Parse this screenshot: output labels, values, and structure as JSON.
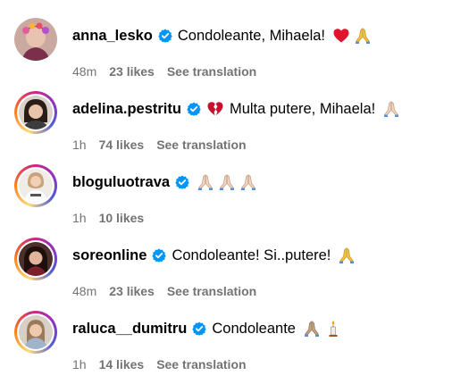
{
  "comments": [
    {
      "username": "anna_lesko",
      "verified": true,
      "text": "Condoleante, Mihaela!",
      "emoji_after": [
        "red-heart",
        "folded-hands"
      ],
      "time": "48m",
      "likes": "23 likes",
      "translate": "See translation"
    },
    {
      "username": "adelina.pestritu",
      "verified": true,
      "emoji_before": [
        "broken-heart"
      ],
      "text": "Multa putere, Mihaela!",
      "emoji_after": [
        "folded-hands"
      ],
      "time": "1h",
      "likes": "74 likes",
      "translate": "See translation"
    },
    {
      "username": "bloguluotrava",
      "verified": true,
      "text": "",
      "emoji_after": [
        "folded-hands",
        "folded-hands",
        "folded-hands"
      ],
      "time": "1h",
      "likes": "10 likes"
    },
    {
      "username": "soreonline",
      "verified": true,
      "text": "Condoleante! Si..putere!",
      "emoji_after": [
        "folded-hands"
      ],
      "time": "48m",
      "likes": "23 likes",
      "translate": "See translation"
    },
    {
      "username": "raluca__dumitru",
      "verified": true,
      "text": "Condoleante",
      "emoji_after": [
        "folded-hands",
        "candle"
      ],
      "time": "1h",
      "likes": "14 likes",
      "translate": "See translation"
    }
  ],
  "colors": {
    "verified_blue": "#0095f6",
    "meta_gray": "#737373"
  }
}
